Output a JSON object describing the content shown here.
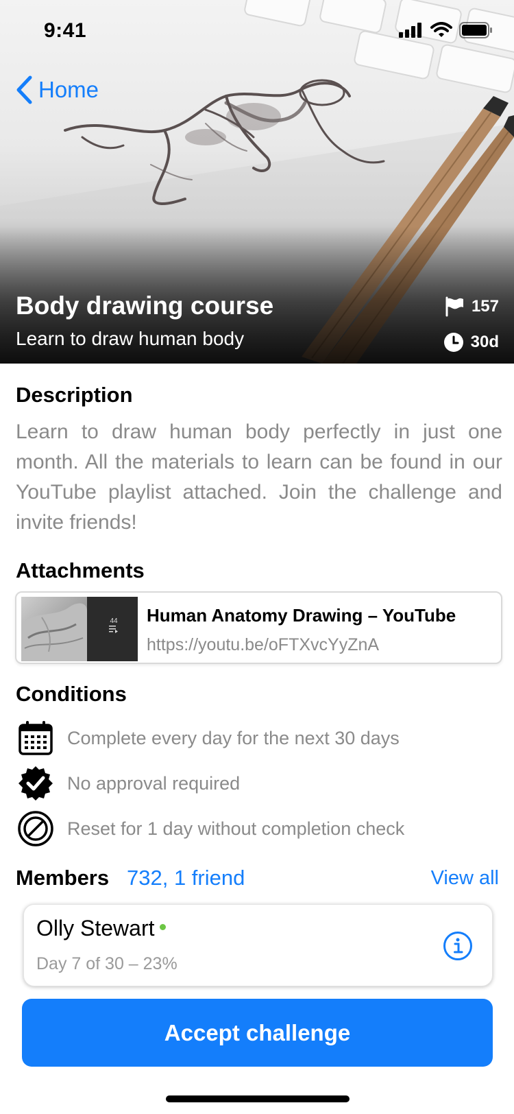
{
  "status_bar": {
    "time": "9:41",
    "icons": [
      "signal-icon",
      "wifi-icon",
      "battery-icon"
    ]
  },
  "nav": {
    "back_label": "Home"
  },
  "hero": {
    "title": "Body drawing course",
    "subtitle": "Learn to draw human body",
    "flags_count": "157",
    "duration": "30d"
  },
  "description": {
    "heading": "Description",
    "text": "Learn to draw human body perfectly in just one month. All the materials to learn can be found in our YouTube playlist attached. Join the challenge and invite friends!"
  },
  "attachments": {
    "heading": "Attachments",
    "items": [
      {
        "title": "Human Anatomy Drawing – YouTube",
        "url": "https://youtu.be/oFTXvcYyZnA",
        "thumb_count": "44"
      }
    ]
  },
  "conditions": {
    "heading": "Conditions",
    "items": [
      {
        "icon": "calendar-icon",
        "text": "Complete every day for the next 30 days"
      },
      {
        "icon": "verified-badge-icon",
        "text": "No approval required"
      },
      {
        "icon": "prohibited-icon",
        "text": "Reset for 1 day without completion check"
      }
    ]
  },
  "members": {
    "heading": "Members",
    "count_text": "732, 1 friend",
    "view_all_label": "View all",
    "list": [
      {
        "name": "Olly Stewart",
        "online": true,
        "progress_text": "Day 7 of 30 – 23%"
      }
    ]
  },
  "actions": {
    "accept_label": "Accept challenge"
  },
  "colors": {
    "accent": "#147EFB",
    "muted_text": "#8a8a8a",
    "online": "#6CC644"
  }
}
